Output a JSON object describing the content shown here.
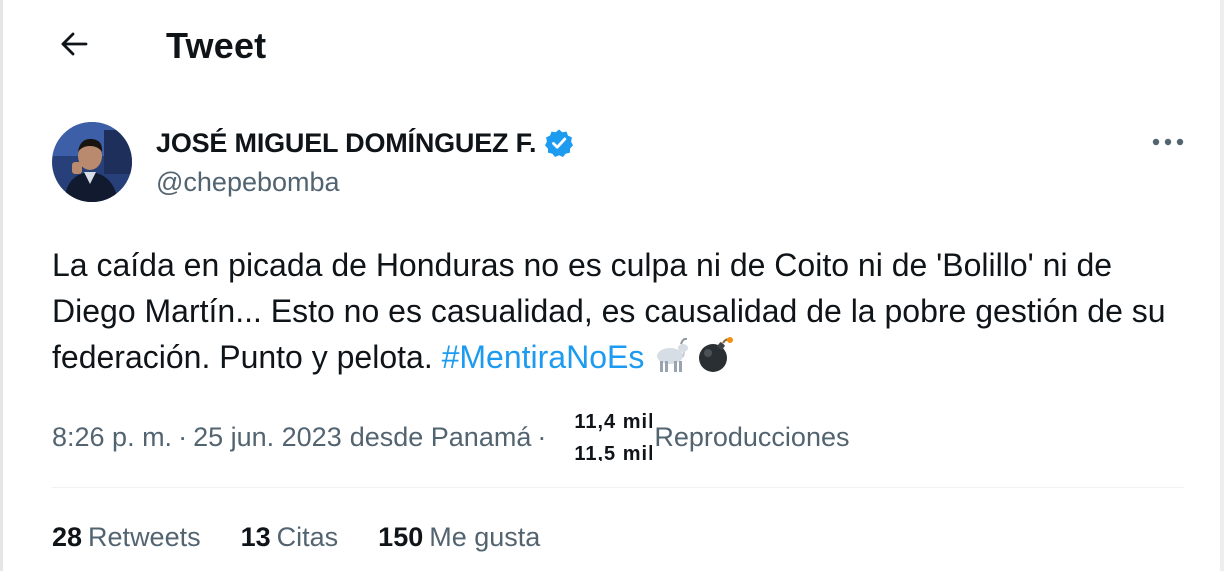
{
  "header": {
    "title": "Tweet",
    "back_icon": "arrow-left-icon"
  },
  "author": {
    "name": "JOSÉ MIGUEL DOMÍNGUEZ F.",
    "handle": "@chepebomba",
    "verified_icon": "verified-badge-icon",
    "avatar": "profile-photo",
    "more_icon": "more-horizontal-icon"
  },
  "tweet": {
    "text": "La caída en picada de Honduras no es culpa ni de Coito ni de 'Bolillo' ni de Diego Martín... Esto no es casualidad, es causalidad de la pobre gestión de su federación. Punto y pelota. ",
    "hashtag": "#MentiraNoEs",
    "emojis": [
      "goat-emoji",
      "bomb-emoji"
    ]
  },
  "meta": {
    "time": "8:26 p. m.",
    "separator": "·",
    "date": "25 jun. 2023",
    "location": "desde Panamá",
    "views_count_top": "11,4 mil",
    "views_count_bottom": "11,5 mil",
    "views_label": "Reproducciones"
  },
  "stats": [
    {
      "count": "28",
      "label": "Retweets"
    },
    {
      "count": "13",
      "label": "Citas"
    },
    {
      "count": "150",
      "label": "Me gusta"
    }
  ],
  "colors": {
    "text": "#0f1419",
    "secondary": "#536471",
    "link": "#1d9bf0",
    "verified": "#1d9bf0",
    "background": "#ffffff"
  }
}
